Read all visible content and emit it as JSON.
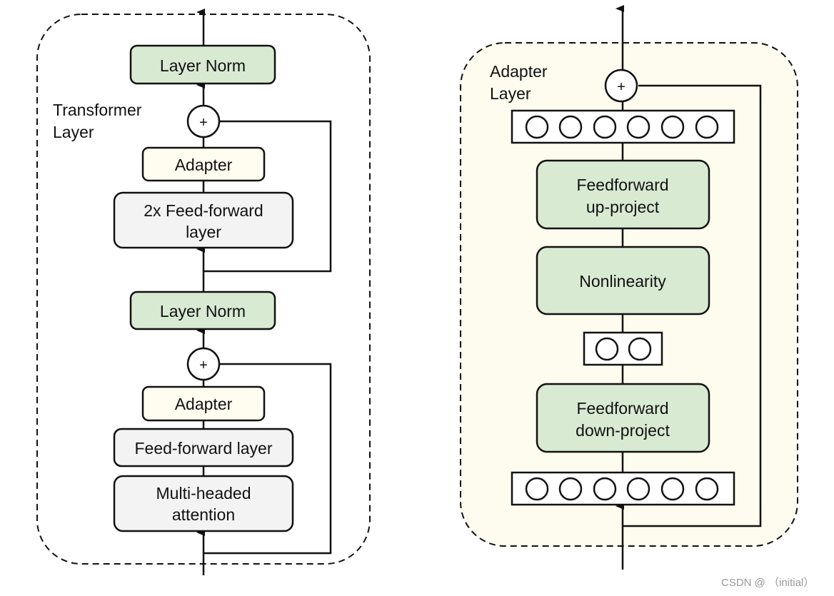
{
  "colors": {
    "green": "#d9ead3",
    "yellow": "#fffdf0",
    "gray": "#f3f3f3",
    "panel": "#fdfcef"
  },
  "transformer": {
    "label_line1": "Transformer",
    "label_line2": "Layer",
    "layer_norm_top": "Layer Norm",
    "adapter_top": "Adapter",
    "ff2x_line1": "2x Feed-forward",
    "ff2x_line2": "layer",
    "layer_norm_bottom": "Layer Norm",
    "adapter_bottom": "Adapter",
    "ff_layer": "Feed-forward layer",
    "mha_line1": "Multi-headed",
    "mha_line2": "attention",
    "plus": "+"
  },
  "adapter": {
    "label_line1": "Adapter",
    "label_line2": "Layer",
    "ff_up_line1": "Feedforward",
    "ff_up_line2": "up-project",
    "nonlinearity": "Nonlinearity",
    "ff_down_line1": "Feedforward",
    "ff_down_line2": "down-project",
    "plus": "+"
  },
  "watermark": "CSDN @ （initial）"
}
